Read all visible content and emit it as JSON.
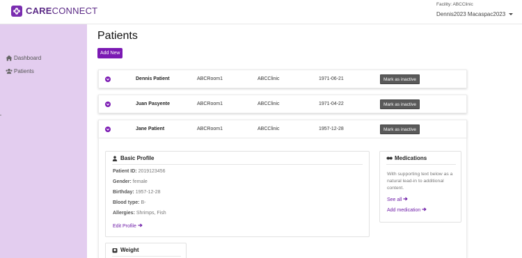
{
  "app": {
    "brand_bold": "CARE",
    "brand_light": "CONNECT",
    "facility": "Facility: ABCClinic",
    "user": "Dennis2023 Macaspac2023"
  },
  "sidebar": {
    "items": [
      {
        "label": "Dashboard",
        "icon": "home-icon"
      },
      {
        "label": "Patients",
        "icon": "users-icon"
      }
    ]
  },
  "main": {
    "title": "Patients",
    "add_label": "Add New"
  },
  "patients": [
    {
      "name": "Dennis Patient",
      "room": "ABCRoom1",
      "clinic": "ABCClinic",
      "birthday": "1971-06-21",
      "action": "Mark as inactive"
    },
    {
      "name": "Juan Pasyente",
      "room": "ABCRoom1",
      "clinic": "ABCClinic",
      "birthday": "1971-04-22",
      "action": "Mark as inactive"
    },
    {
      "name": "Jane Patient",
      "room": "ABCRoom1",
      "clinic": "ABCClinic",
      "birthday": "1957-12-28",
      "action": "Mark as inactive"
    }
  ],
  "basic_profile": {
    "title": "Basic Profile",
    "fields": [
      {
        "label": "Patient ID:",
        "value": "2019123456"
      },
      {
        "label": "Gender:",
        "value": "female"
      },
      {
        "label": "Birthday:",
        "value": "1957-12-28"
      },
      {
        "label": "Blood type:",
        "value": "B-"
      },
      {
        "label": "Allergies:",
        "value": "Shrimps, Fish"
      }
    ],
    "edit_label": "Edit Profile"
  },
  "medications": {
    "title": "Medications",
    "text": "With supporting text below as a natural lead-in to additional content.",
    "see_all": "See all",
    "add": "Add medication"
  },
  "weight": {
    "title": "Weight"
  },
  "colors": {
    "accent": "#7b19b3",
    "sidebar_bg": "#e3cdef",
    "inactive_btn": "#5a5a5a"
  }
}
